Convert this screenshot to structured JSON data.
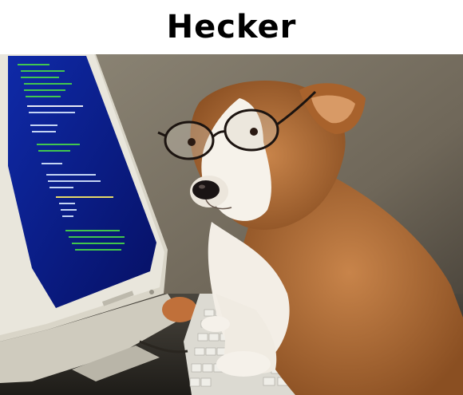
{
  "caption": {
    "title": "Hecker"
  },
  "photo": {
    "description_icon": "dog-at-computer-photo",
    "colors": {
      "wall": "#7c7466",
      "monitor_bezel": "#e6e2d6",
      "screen_bg": "#0a1a8c",
      "code_green": "#48d848",
      "dog_fur_brown": "#b3703a",
      "dog_fur_white": "#f3eee6",
      "keyboard": "#dcdad2"
    }
  }
}
